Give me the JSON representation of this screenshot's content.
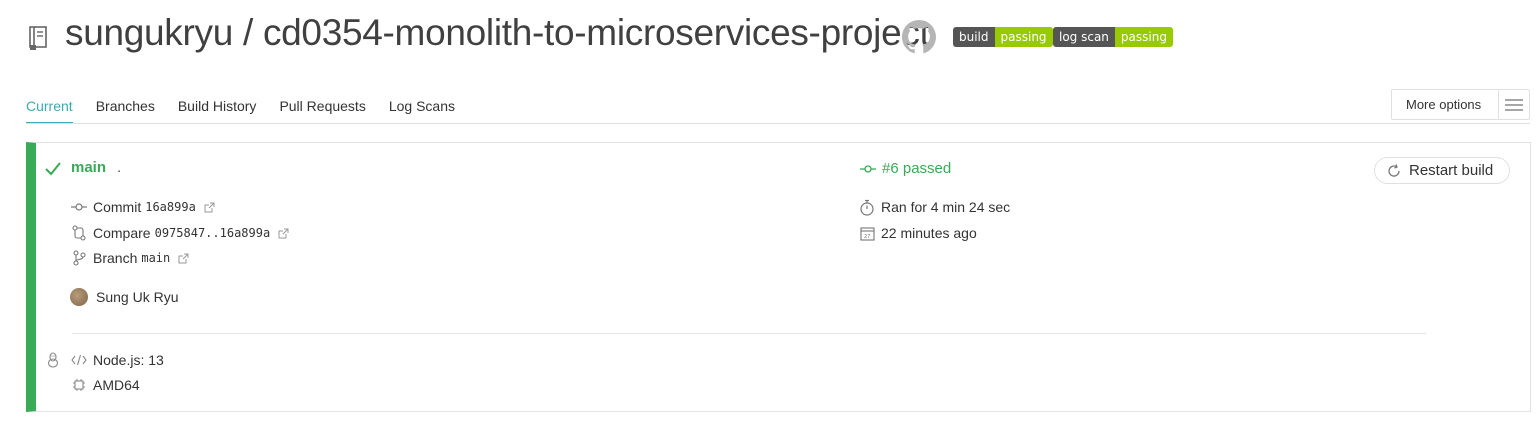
{
  "header": {
    "title": "sungukryu / cd0354-monolith-to-microservices-project",
    "badges": [
      {
        "label": "build",
        "status": "passing"
      },
      {
        "label": "log scan",
        "status": "passing"
      }
    ]
  },
  "tabs": [
    "Current",
    "Branches",
    "Build History",
    "Pull Requests",
    "Log Scans"
  ],
  "more_options": "More options",
  "build": {
    "branch": "main",
    "branch_suffix": ".",
    "status": "#6 passed",
    "restart_label": "Restart build",
    "commit_label": "Commit",
    "commit_sha": "16a899a",
    "compare_label": "Compare",
    "compare_range": "0975847..16a899a",
    "branch_label": "Branch",
    "branch_value": "main",
    "author": "Sung Uk Ryu",
    "duration": "Ran for 4 min 24 sec",
    "finished": "22 minutes ago",
    "language": "Node.js: 13",
    "arch": "AMD64"
  },
  "colors": {
    "passed_green": "#39aa56",
    "tab_active": "#3eaaaf",
    "badge_dark": "#555555",
    "badge_green": "#97ca00"
  }
}
